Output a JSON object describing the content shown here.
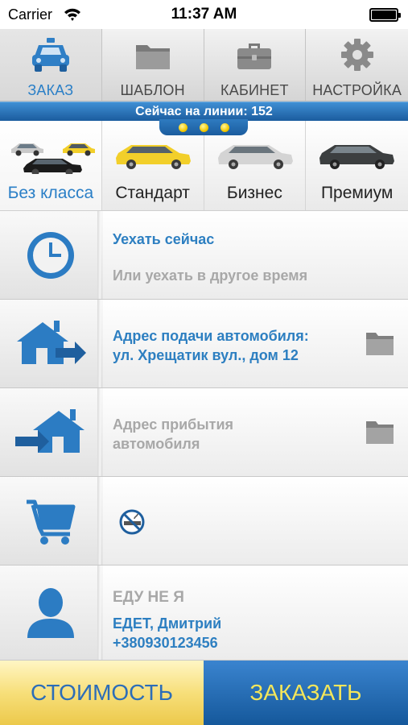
{
  "status_bar": {
    "carrier": "Carrier",
    "time": "11:37 AM"
  },
  "tabs": [
    {
      "label": "ЗАКАЗ",
      "icon": "taxi-car-icon",
      "active": true
    },
    {
      "label": "ШАБЛОН",
      "icon": "folder-icon"
    },
    {
      "label": "КАБИНЕТ",
      "icon": "briefcase-icon"
    },
    {
      "label": "НАСТРОЙКА",
      "icon": "gear-icon"
    }
  ],
  "online": {
    "text": "Сейчас на линии: 152"
  },
  "classes": [
    {
      "label": "Без класса",
      "active": true
    },
    {
      "label": "Стандарт"
    },
    {
      "label": "Бизнес"
    },
    {
      "label": "Премиум"
    }
  ],
  "time_row": {
    "title": "Уехать сейчас",
    "subtitle": "Или уехать в другое время"
  },
  "pickup_row": {
    "line1": "Адрес подачи автомобиля:",
    "line2": "ул. Хрещатик вул., дом 12"
  },
  "dest_row": {
    "line1": "Адрес прибытия",
    "line2": "автомобиля"
  },
  "passenger_row": {
    "not_me": "ЕДУ НЕ Я",
    "name": "ЕДЕТ, Дмитрий",
    "phone": "+380930123456"
  },
  "actions": {
    "cost": "СТОИМОСТЬ",
    "order": "ЗАКАЗАТЬ"
  },
  "colors": {
    "accent_blue": "#2d7fc1",
    "order_text_yellow": "#f4e65a",
    "cost_bg_yellow": "#f7df7a"
  }
}
